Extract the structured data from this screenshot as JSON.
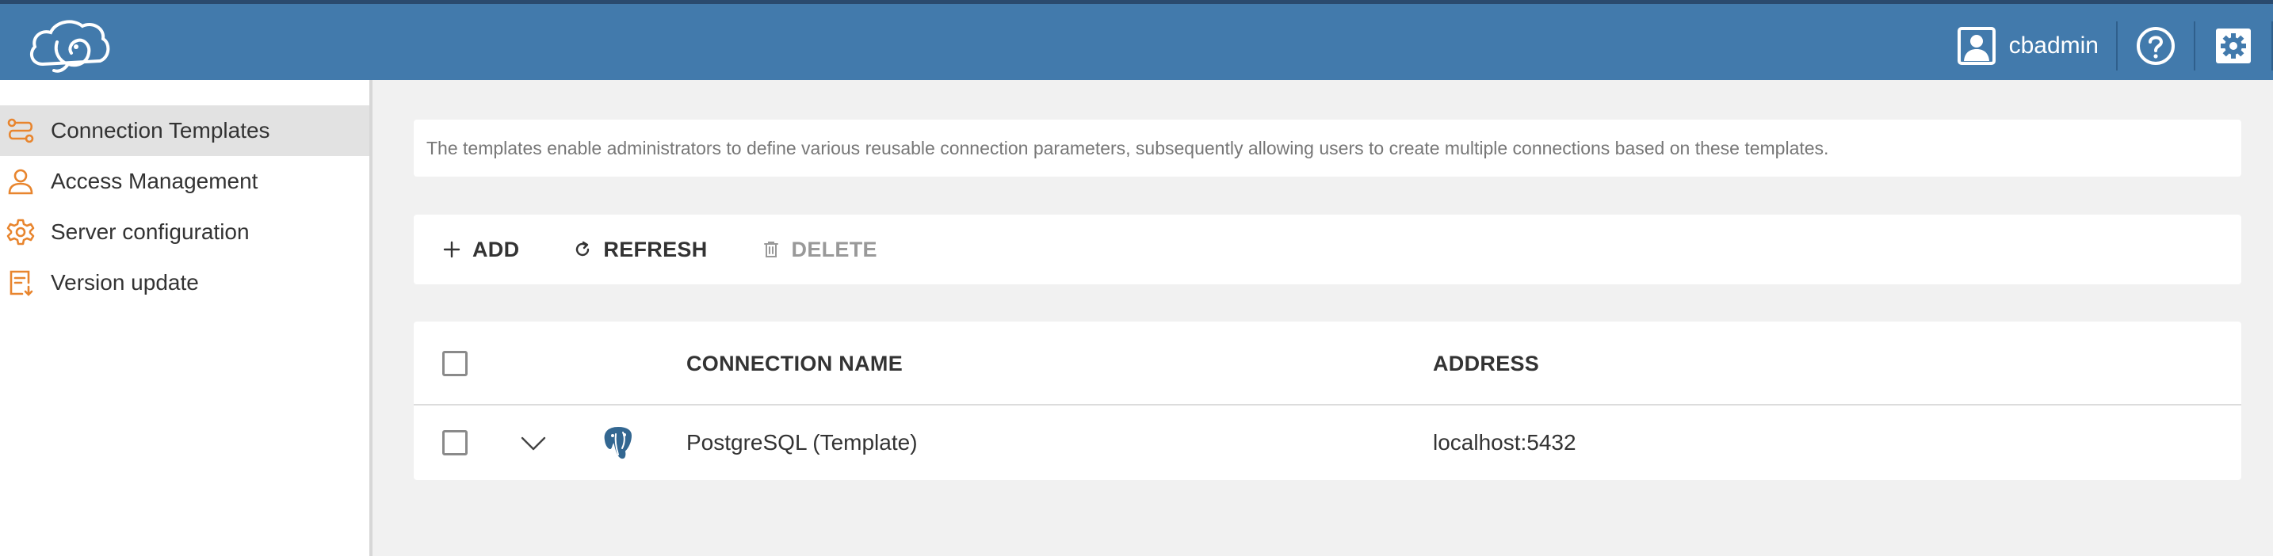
{
  "header": {
    "logo_icon": "cloudbeaver-logo-icon",
    "user": {
      "icon": "user-icon",
      "name": "cbadmin"
    },
    "help_icon": "help-icon",
    "settings_icon": "settings-icon",
    "background": "#427aac"
  },
  "sidebar": {
    "items": [
      {
        "label": "Connection Templates",
        "icon": "connection-templates-icon",
        "active": true
      },
      {
        "label": "Access Management",
        "icon": "user-icon",
        "active": false
      },
      {
        "label": "Server configuration",
        "icon": "gear-icon",
        "active": false
      },
      {
        "label": "Version update",
        "icon": "version-update-icon",
        "active": false
      }
    ],
    "icon_color": "#e8852e"
  },
  "main": {
    "description": "The templates enable administrators to define various reusable connection parameters, subsequently allowing users to create multiple connections based on these templates.",
    "toolbar": {
      "add_label": "ADD",
      "refresh_label": "REFRESH",
      "delete_label": "DELETE"
    },
    "table": {
      "columns": [
        "CONNECTION NAME",
        "ADDRESS"
      ],
      "rows": [
        {
          "name": "PostgreSQL (Template)",
          "address": "localhost:5432",
          "icon": "postgresql-icon"
        }
      ]
    }
  }
}
